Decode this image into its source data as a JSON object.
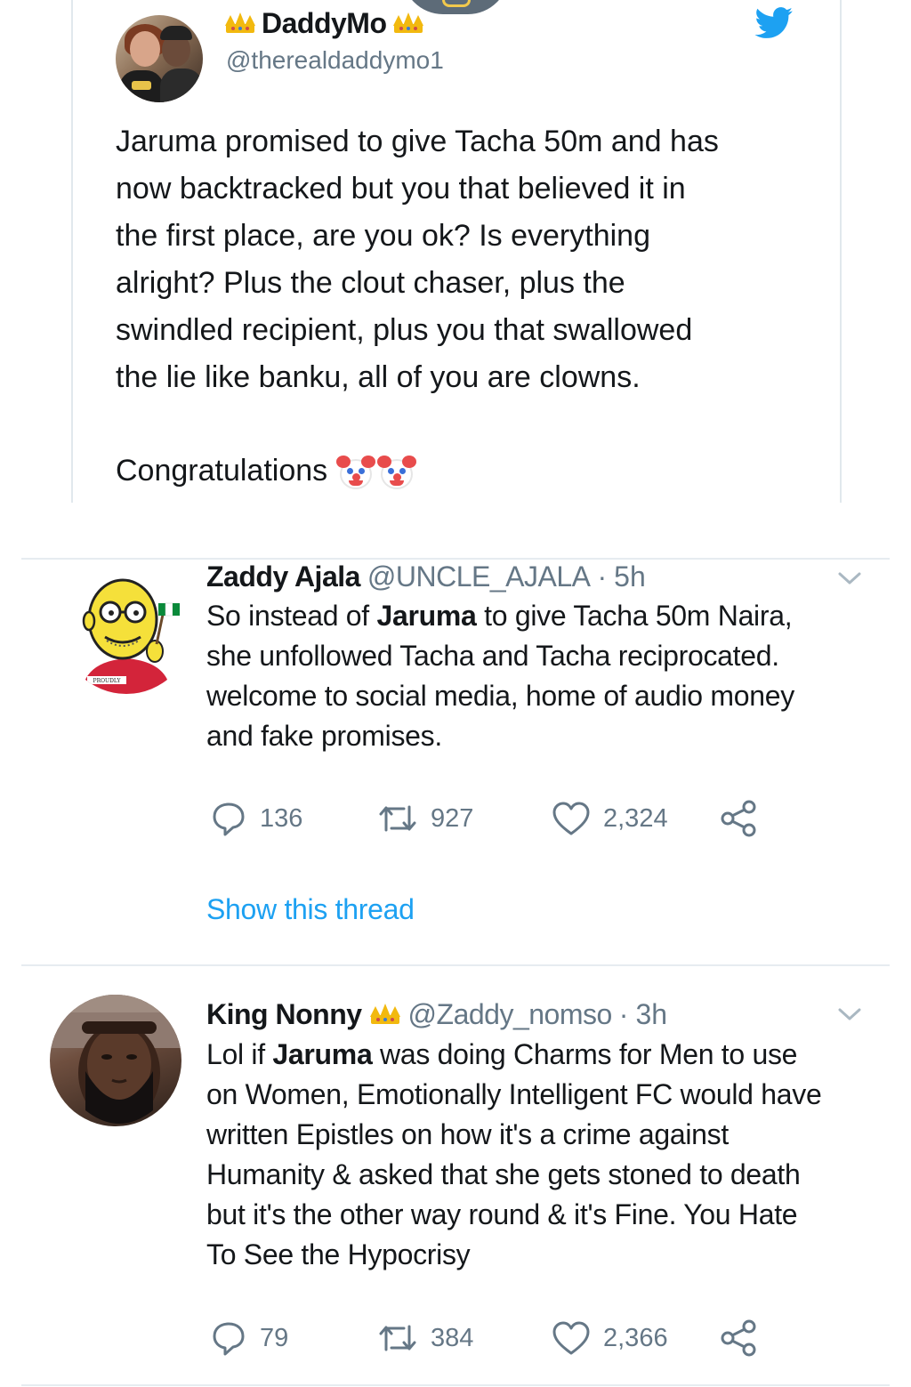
{
  "embedded_tweet": {
    "name": "DaddyMo",
    "handle": "@therealdaddymo1",
    "text": "Jaruma promised to give Tacha 50m and has\nnow backtracked but you that believed it in\nthe first place, are you ok? Is everything\nalright? Plus the clout chaser, plus the\nswindled recipient, plus you that swallowed\nthe lie like banku, all of you are clowns.",
    "closing": "Congratulations",
    "icons": [
      "crown-icon",
      "twitter-bird-icon",
      "clown-face-icon"
    ],
    "brand_color": "#1da1f2"
  },
  "tweets": [
    {
      "name": "Zaddy Ajala",
      "handle": "@UNCLE_AJALA",
      "separator": "·",
      "time": "5h",
      "body": {
        "l1_pre": "So instead of ",
        "l1_bold": "Jaruma",
        "l1_post": " to give Tacha 50m Naira,",
        "l2": "she unfollowed Tacha and Tacha reciprocated.",
        "l3": "welcome to social media, home of audio money",
        "l4": "and fake promises."
      },
      "replies": "136",
      "retweets": "927",
      "likes": "2,324",
      "show_thread": "Show this thread",
      "avatar_badge_text": "PROUDLY"
    },
    {
      "name": "King Nonny",
      "handle": "@Zaddy_nomso",
      "separator": "·",
      "time": "3h",
      "body": {
        "l1_pre": "Lol if ",
        "l1_bold": "Jaruma",
        "l1_post": " was doing Charms for Men to use",
        "l2": "on Women, Emotionally Intelligent FC would have",
        "l3": "written Epistles on how it's a crime against",
        "l4": "Humanity & asked that she gets stoned to death",
        "l5": "but it's the other way round & it's Fine. You Hate",
        "l6": "To See the Hypocrisy"
      },
      "replies": "79",
      "retweets": "384",
      "likes": "2,366"
    }
  ],
  "colors": {
    "text": "#14171a",
    "secondary": "#657786",
    "link": "#1da1f2",
    "divider": "#e6ecf0"
  }
}
